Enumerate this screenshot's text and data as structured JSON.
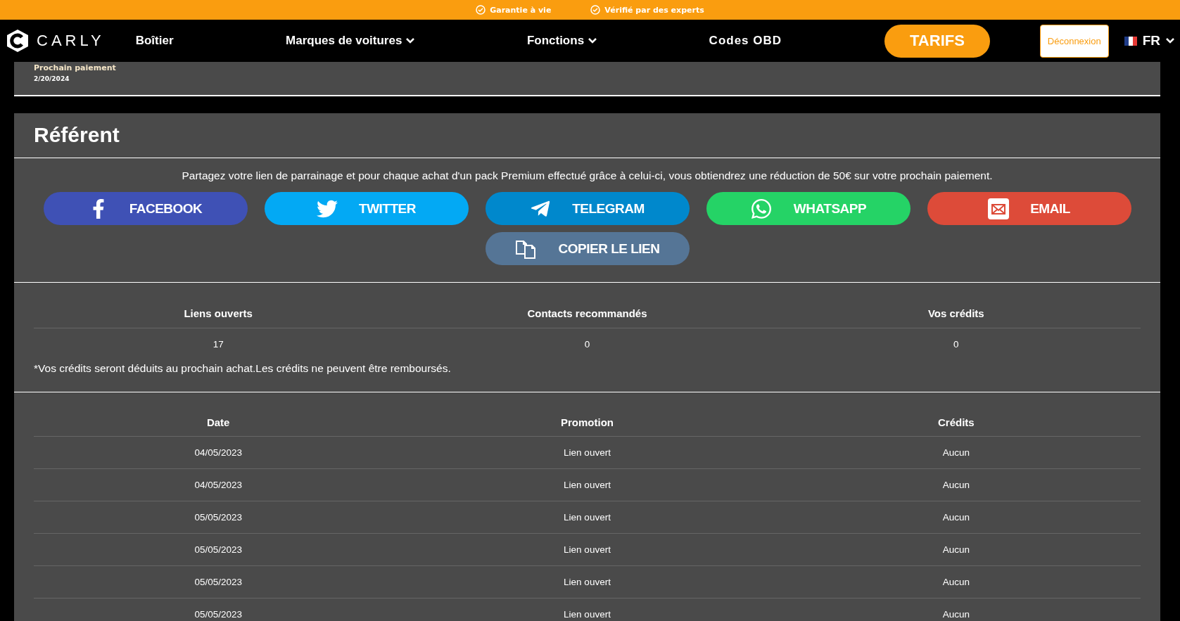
{
  "promo_bar": [
    "Garantie à vie",
    "Vérifié par des experts"
  ],
  "nav": {
    "logo": "CARLY",
    "links": [
      {
        "label": "Boîtier",
        "dropdown": false
      },
      {
        "label": "Marques de voitures",
        "dropdown": true
      },
      {
        "label": "Fonctions",
        "dropdown": true
      },
      {
        "label": "Codes OBD",
        "dropdown": false
      }
    ],
    "cta": "TARIFS",
    "logout": "Déconnexion",
    "language": "FR"
  },
  "next_payment": {
    "label": "Prochain paiement",
    "date": "2/20/2024"
  },
  "referral": {
    "title": "Référent",
    "description": "Partagez votre lien de parrainage et pour chaque achat d'un pack Premium effectué grâce à celui-ci, vous obtiendrez une réduction de 50€ sur votre prochain paiement.",
    "share_buttons": [
      {
        "kind": "facebook",
        "label": "FACEBOOK"
      },
      {
        "kind": "twitter",
        "label": "TWITTER"
      },
      {
        "kind": "telegram",
        "label": "TELEGRAM"
      },
      {
        "kind": "whatsapp",
        "label": "WHATSAPP"
      },
      {
        "kind": "email",
        "label": "EMAIL"
      },
      {
        "kind": "copy",
        "label": "COPIER LE LIEN"
      }
    ],
    "stats": {
      "columns": [
        "Liens ouverts",
        "Contacts recommandés",
        "Vos crédits"
      ],
      "values": [
        "17",
        "0",
        "0"
      ]
    },
    "note": "*Vos crédits seront déduits au prochain achat.Les crédits ne peuvent être remboursés.",
    "history": {
      "columns": [
        "Date",
        "Promotion",
        "Crédits"
      ],
      "rows": [
        [
          "04/05/2023",
          "Lien ouvert",
          "Aucun"
        ],
        [
          "04/05/2023",
          "Lien ouvert",
          "Aucun"
        ],
        [
          "05/05/2023",
          "Lien ouvert",
          "Aucun"
        ],
        [
          "05/05/2023",
          "Lien ouvert",
          "Aucun"
        ],
        [
          "05/05/2023",
          "Lien ouvert",
          "Aucun"
        ],
        [
          "05/05/2023",
          "Lien ouvert",
          "Aucun"
        ]
      ]
    }
  }
}
